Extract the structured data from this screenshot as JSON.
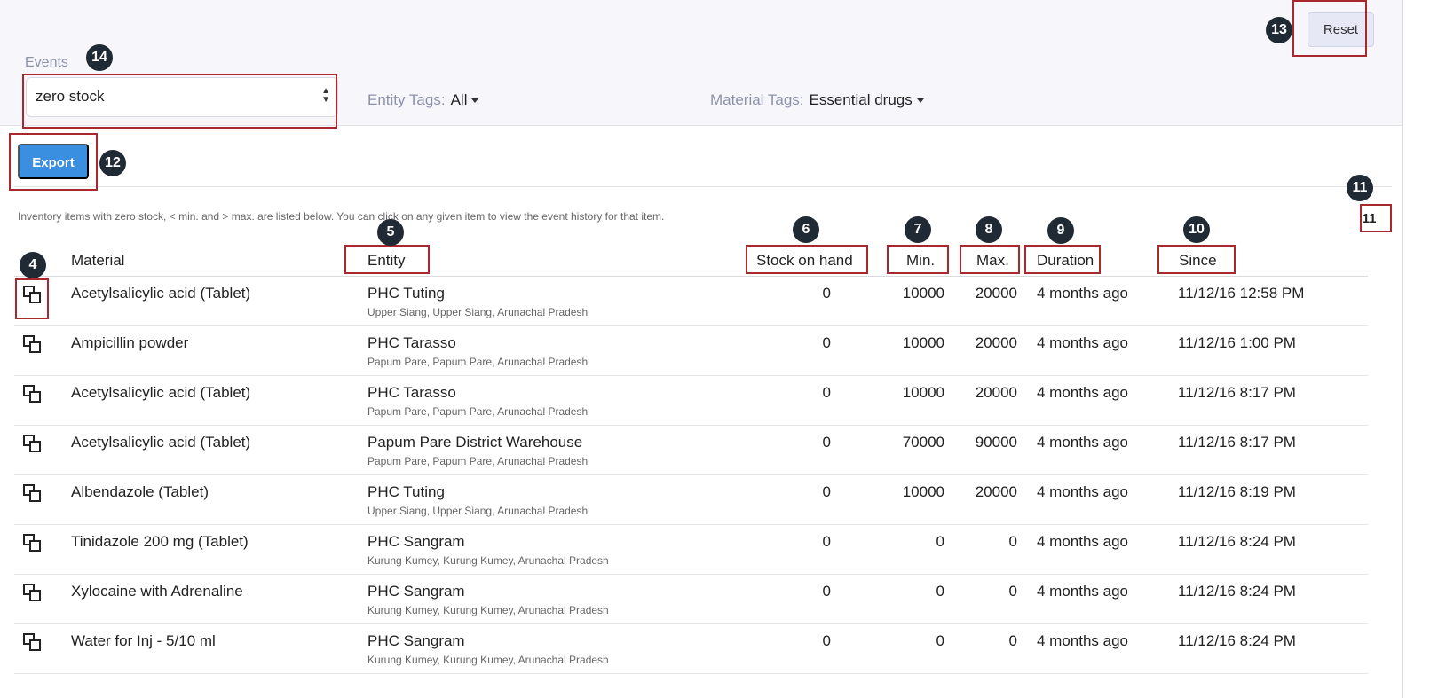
{
  "header": {
    "reset_label": "Reset"
  },
  "filters": {
    "events_label": "Events",
    "events_value": "zero stock",
    "entity_tags_label": "Entity Tags:",
    "entity_tags_value": "All",
    "material_tags_label": "Material Tags:",
    "material_tags_value": "Essential drugs"
  },
  "toolbar": {
    "export_label": "Export"
  },
  "info_text": "Inventory items with zero stock, < min. and > max. are listed below. You can click on any given item to view the event history for that item.",
  "result_count": "11",
  "callouts": [
    "4",
    "5",
    "6",
    "7",
    "8",
    "9",
    "10",
    "11",
    "12",
    "13",
    "14"
  ],
  "table": {
    "columns": {
      "material": "Material",
      "entity": "Entity",
      "stock": "Stock on hand",
      "min": "Min.",
      "max": "Max.",
      "duration": "Duration",
      "since": "Since"
    },
    "rows": [
      {
        "material": "Acetylsalicylic acid (Tablet)",
        "entity": "PHC Tuting",
        "location": "Upper Siang, Upper Siang, Arunachal Pradesh",
        "stock": "0",
        "min": "10000",
        "max": "20000",
        "duration": "4 months ago",
        "since": "11/12/16 12:58 PM"
      },
      {
        "material": "Ampicillin powder",
        "entity": "PHC Tarasso",
        "location": "Papum Pare, Papum Pare, Arunachal Pradesh",
        "stock": "0",
        "min": "10000",
        "max": "20000",
        "duration": "4 months ago",
        "since": "11/12/16 1:00 PM"
      },
      {
        "material": "Acetylsalicylic acid (Tablet)",
        "entity": "PHC Tarasso",
        "location": "Papum Pare, Papum Pare, Arunachal Pradesh",
        "stock": "0",
        "min": "10000",
        "max": "20000",
        "duration": "4 months ago",
        "since": "11/12/16 8:17 PM"
      },
      {
        "material": "Acetylsalicylic acid (Tablet)",
        "entity": "Papum Pare District Warehouse",
        "location": "Papum Pare, Papum Pare, Arunachal Pradesh",
        "stock": "0",
        "min": "70000",
        "max": "90000",
        "duration": "4 months ago",
        "since": "11/12/16 8:17 PM"
      },
      {
        "material": "Albendazole (Tablet)",
        "entity": "PHC Tuting",
        "location": "Upper Siang, Upper Siang, Arunachal Pradesh",
        "stock": "0",
        "min": "10000",
        "max": "20000",
        "duration": "4 months ago",
        "since": "11/12/16 8:19 PM"
      },
      {
        "material": "Tinidazole 200 mg (Tablet)",
        "entity": "PHC Sangram",
        "location": "Kurung Kumey, Kurung Kumey, Arunachal Pradesh",
        "stock": "0",
        "min": "0",
        "max": "0",
        "duration": "4 months ago",
        "since": "11/12/16 8:24 PM"
      },
      {
        "material": "Xylocaine with Adrenaline",
        "entity": "PHC Sangram",
        "location": "Kurung Kumey, Kurung Kumey, Arunachal Pradesh",
        "stock": "0",
        "min": "0",
        "max": "0",
        "duration": "4 months ago",
        "since": "11/12/16 8:24 PM"
      },
      {
        "material": "Water for Inj - 5/10 ml",
        "entity": "PHC Sangram",
        "location": "Kurung Kumey, Kurung Kumey, Arunachal Pradesh",
        "stock": "0",
        "min": "0",
        "max": "0",
        "duration": "4 months ago",
        "since": "11/12/16 8:24 PM"
      }
    ]
  }
}
